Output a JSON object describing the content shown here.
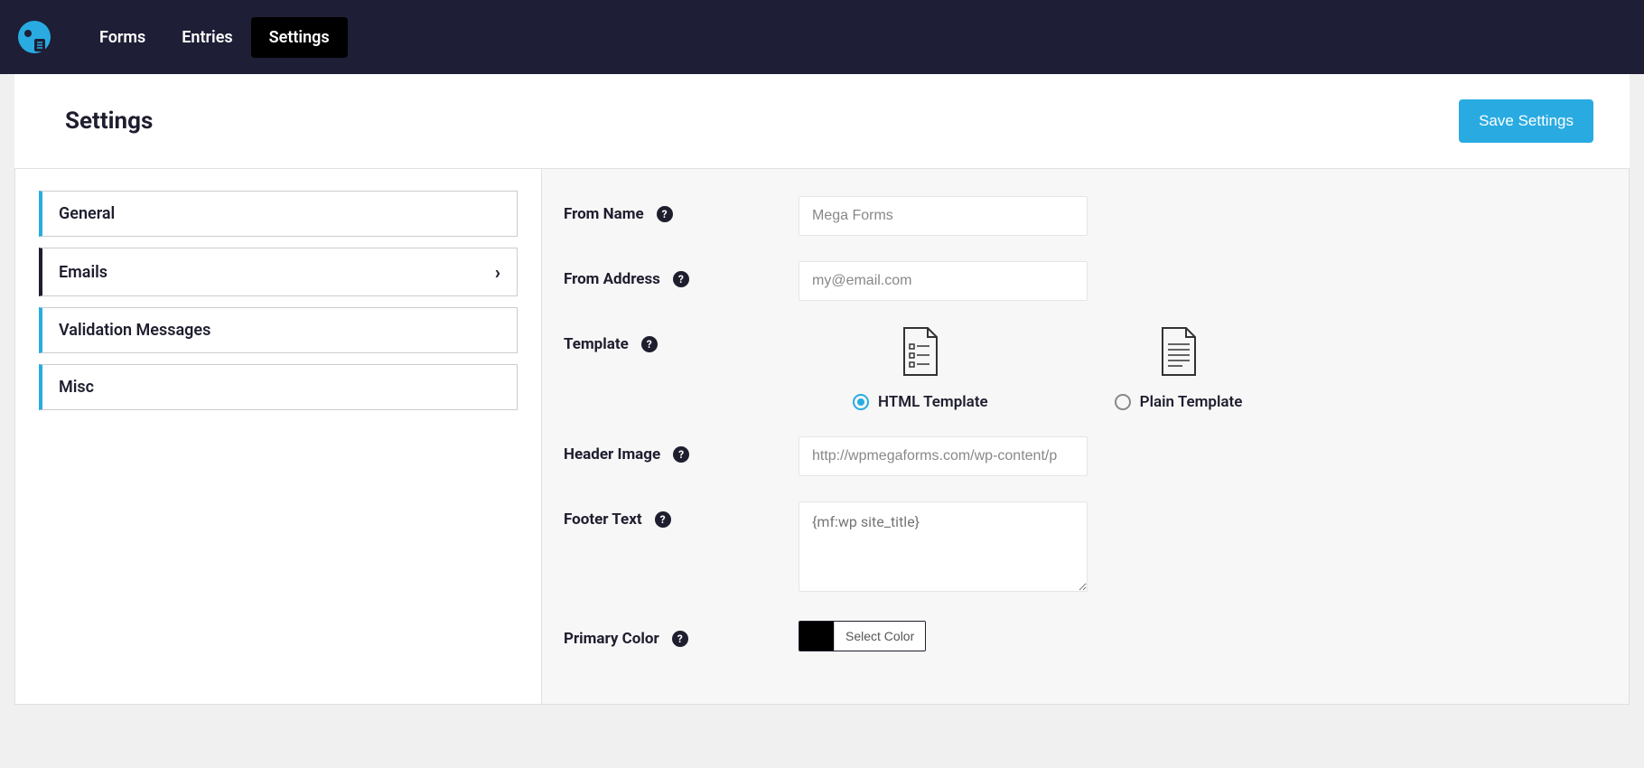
{
  "topNav": {
    "items": [
      {
        "label": "Forms"
      },
      {
        "label": "Entries"
      },
      {
        "label": "Settings"
      }
    ]
  },
  "header": {
    "title": "Settings",
    "saveLabel": "Save Settings"
  },
  "sidebar": {
    "tabs": [
      {
        "label": "General"
      },
      {
        "label": "Emails"
      },
      {
        "label": "Validation Messages"
      },
      {
        "label": "Misc"
      }
    ]
  },
  "form": {
    "fromName": {
      "label": "From Name",
      "placeholder": "Mega Forms"
    },
    "fromAddress": {
      "label": "From Address",
      "placeholder": "my@email.com"
    },
    "template": {
      "label": "Template",
      "htmlLabel": "HTML Template",
      "plainLabel": "Plain Template"
    },
    "headerImage": {
      "label": "Header Image",
      "placeholder": "http://wpmegaforms.com/wp-content/p"
    },
    "footerText": {
      "label": "Footer Text",
      "placeholder": "{mf:wp site_title}"
    },
    "primaryColor": {
      "label": "Primary Color",
      "buttonLabel": "Select Color",
      "swatch": "#000000"
    }
  }
}
